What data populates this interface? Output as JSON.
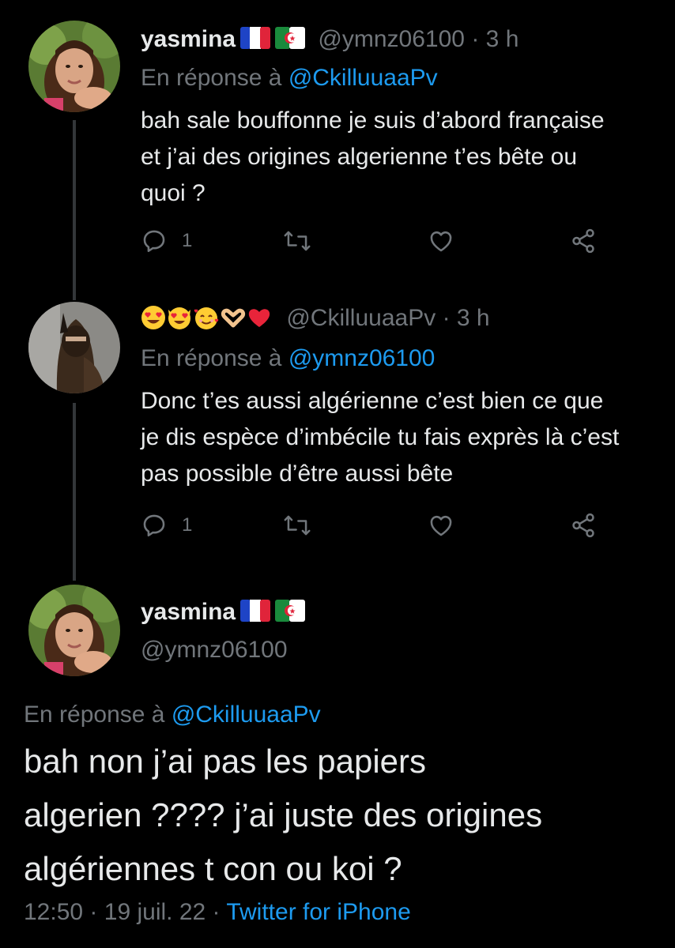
{
  "tweets": [
    {
      "name": "yasmina",
      "handle": "@ymnz06100",
      "time": "3 h",
      "reply_prefix": "En réponse à",
      "reply_handle": "@CkilluuaaPv",
      "text_lines": [
        "bah sale bouffonne je suis d’abord française",
        "et j’ai des origines algerienne t’es bête ou",
        "quoi ?"
      ],
      "reply_count": "1",
      "flags": [
        "flag-france-icon",
        "flag-algeria-icon"
      ]
    },
    {
      "name_emojis": [
        "heart-eyes-emoji",
        "heart-eyes-cat-emoji",
        "smiling-face-with-hearts-emoji",
        "heart-hands-emoji",
        "red-heart-emoji"
      ],
      "handle": "@CkilluuaaPv",
      "time": "3 h",
      "reply_prefix": "En réponse à",
      "reply_handle": "@ymnz06100",
      "text_lines": [
        "Donc t’es aussi algérienne c’est bien ce que",
        "je dis espèce d’imbécile tu fais exprès là c’est",
        "pas possible d’être aussi bête"
      ],
      "reply_count": "1"
    }
  ],
  "main_tweet": {
    "name": "yasmina",
    "handle": "@ymnz06100",
    "reply_prefix": "En réponse à",
    "reply_handle": "@CkilluuaaPv",
    "text_lines": [
      "bah non j’ai pas les papiers",
      "algerien ???? j’ai juste des origines",
      "algériennes t con ou koi ?"
    ],
    "time": "12:50",
    "date": "19 juil. 22",
    "source": "Twitter for iPhone"
  },
  "separator": "·",
  "colors": {
    "background": "#000000",
    "text": "#e7e9ea",
    "secondary": "#71767b",
    "link": "#1d9bf0"
  }
}
